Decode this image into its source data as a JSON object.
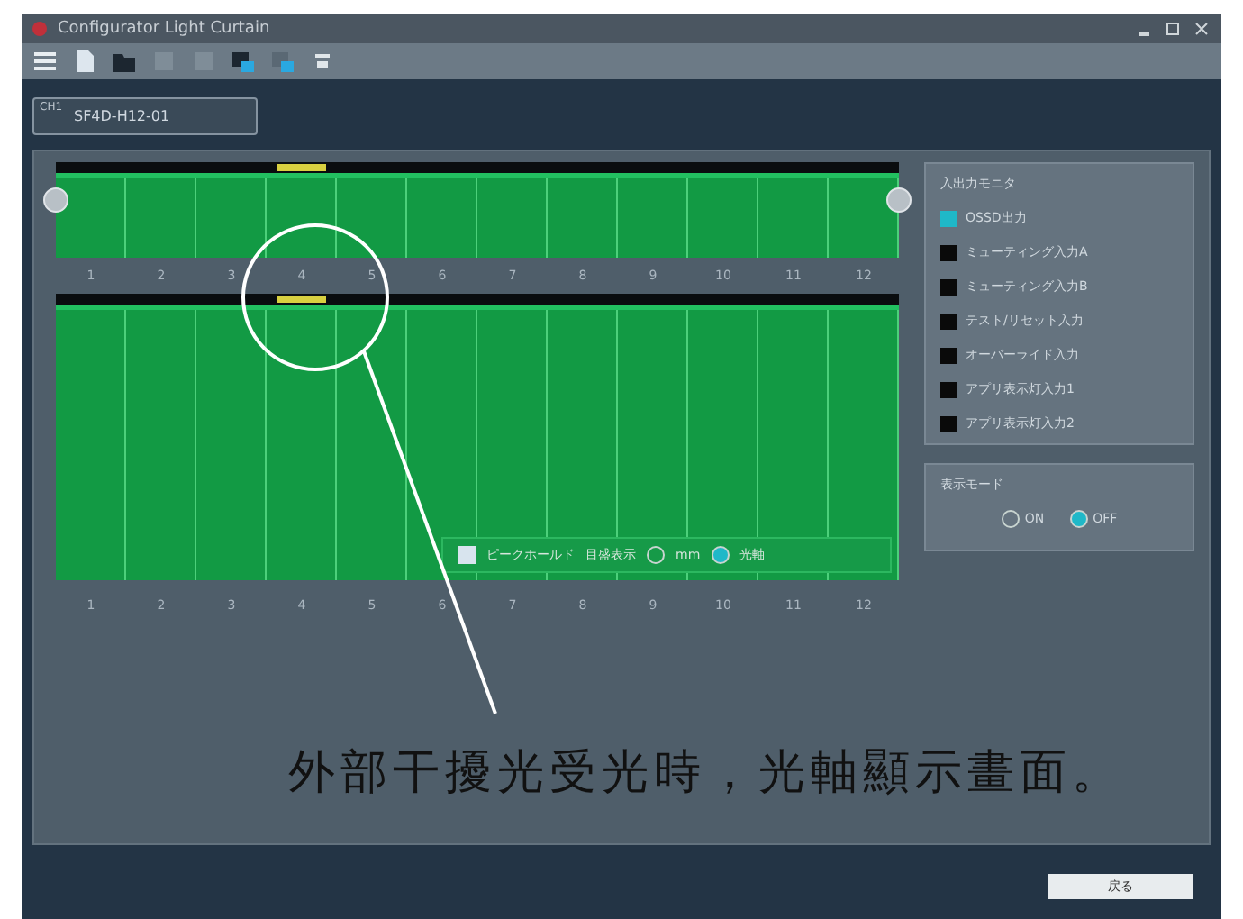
{
  "window": {
    "title": "Configurator Light Curtain"
  },
  "device": {
    "label": "CH1",
    "value": "SF4D-H12-01"
  },
  "top_chart": {
    "beams": [
      {
        "label": "1",
        "flagged": false
      },
      {
        "label": "2",
        "flagged": false
      },
      {
        "label": "3",
        "flagged": false
      },
      {
        "label": "4",
        "flagged": true
      },
      {
        "label": "5",
        "flagged": false
      },
      {
        "label": "6",
        "flagged": false
      },
      {
        "label": "7",
        "flagged": false
      },
      {
        "label": "8",
        "flagged": false
      },
      {
        "label": "9",
        "flagged": false
      },
      {
        "label": "10",
        "flagged": false
      },
      {
        "label": "11",
        "flagged": false
      },
      {
        "label": "12",
        "flagged": false
      }
    ]
  },
  "main_chart": {
    "beams": [
      {
        "label": "1",
        "flagged": false
      },
      {
        "label": "2",
        "flagged": false
      },
      {
        "label": "3",
        "flagged": false
      },
      {
        "label": "4",
        "flagged": true
      },
      {
        "label": "5",
        "flagged": false
      },
      {
        "label": "6",
        "flagged": false
      },
      {
        "label": "7",
        "flagged": false
      },
      {
        "label": "8",
        "flagged": false
      },
      {
        "label": "9",
        "flagged": false
      },
      {
        "label": "10",
        "flagged": false
      },
      {
        "label": "11",
        "flagged": false
      },
      {
        "label": "12",
        "flagged": false
      }
    ],
    "options": {
      "peak_hold": {
        "label": "ピークホールド",
        "checked": true
      },
      "scale_label": "目盛表示",
      "units": [
        {
          "label": "mm",
          "selected": false
        },
        {
          "label": "光軸",
          "selected": true
        }
      ]
    }
  },
  "monitor": {
    "title": "入出力モニタ",
    "items": [
      {
        "label": "OSSD出力",
        "color": "#1fb8c8"
      },
      {
        "label": "ミューティング入力A",
        "color": "#0a0a0a"
      },
      {
        "label": "ミューティング入力B",
        "color": "#0a0a0a"
      },
      {
        "label": "テスト/リセット入力",
        "color": "#0a0a0a"
      },
      {
        "label": "オーバーライド入力",
        "color": "#0a0a0a"
      },
      {
        "label": "アプリ表示灯入力1",
        "color": "#0a0a0a"
      },
      {
        "label": "アプリ表示灯入力2",
        "color": "#0a0a0a"
      }
    ]
  },
  "display_mode": {
    "title": "表示モード",
    "options": [
      {
        "label": "ON",
        "selected": false
      },
      {
        "label": "OFF",
        "selected": true
      }
    ]
  },
  "annotation": "外部干擾光受光時，光軸顯示畫面。",
  "close_button": "戻る"
}
